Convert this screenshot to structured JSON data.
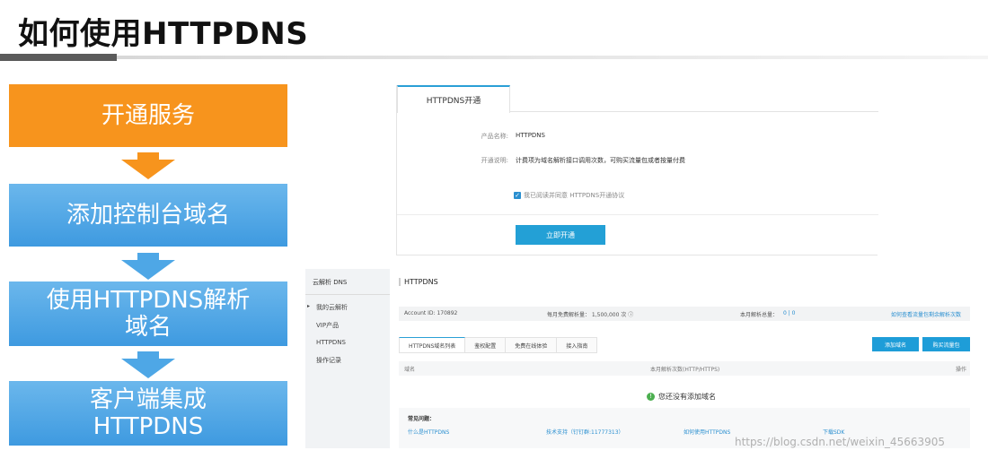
{
  "slide": {
    "title": "如何使用HTTPDNS"
  },
  "flow": {
    "steps": [
      {
        "line1": "开通服务",
        "line2": ""
      },
      {
        "line1": "添加控制台域名",
        "line2": ""
      },
      {
        "line1": "使用HTTPDNS解析",
        "line2": "域名"
      },
      {
        "line1": "客户端集成",
        "line2": "HTTPDNS"
      }
    ],
    "colors": {
      "first": "#f7941d",
      "rest": "#4ea7e6"
    }
  },
  "activation_panel": {
    "tab_label": "HTTPDNS开通",
    "product_name_label": "产品名称:",
    "product_name_value": "HTTPDNS",
    "description_label": "开通说明:",
    "description_value": "计费项为域名解析接口调用次数，可购买流量包或者按量付费",
    "agreement_text": "我已阅读并同意 HTTPDNS开通协议",
    "agreement_checked": true,
    "activate_button": "立即开通",
    "accent_color": "#23a0d6"
  },
  "console_panel": {
    "sidebar": {
      "header": "云解析 DNS",
      "items": [
        "我的云解析",
        "VIP产品",
        "HTTPDNS",
        "操作记录"
      ]
    },
    "title": "HTTPDNS",
    "info_bar": {
      "account": "Account ID: 170892",
      "free_quota": "每月免费解析量： 1,500,000 次 ⓘ",
      "monthly_total_label": "本月解析总量：",
      "monthly_total_value": "0 | 0",
      "traffic_link": "如何查看流量包剩余解析次数"
    },
    "tabs": [
      "HTTPDNS域名列表",
      "鉴权配置",
      "免费在线体验",
      "接入指南"
    ],
    "buttons": {
      "add_domain": "添加域名",
      "buy_package": "购买流量包"
    },
    "table_headers": {
      "domain": "域名",
      "monthly_count": "本月解析次数(HTTP/HTTPS)",
      "action": "操作"
    },
    "empty_message": "您还没有添加域名",
    "faq": {
      "title": "常见问题：",
      "links": [
        "什么是HTTPDNS",
        "技术支持（钉钉群:11777313）",
        "如何使用HTTPDNS",
        "下载SDK"
      ]
    }
  },
  "watermark": "https://blog.csdn.net/weixin_45663905"
}
